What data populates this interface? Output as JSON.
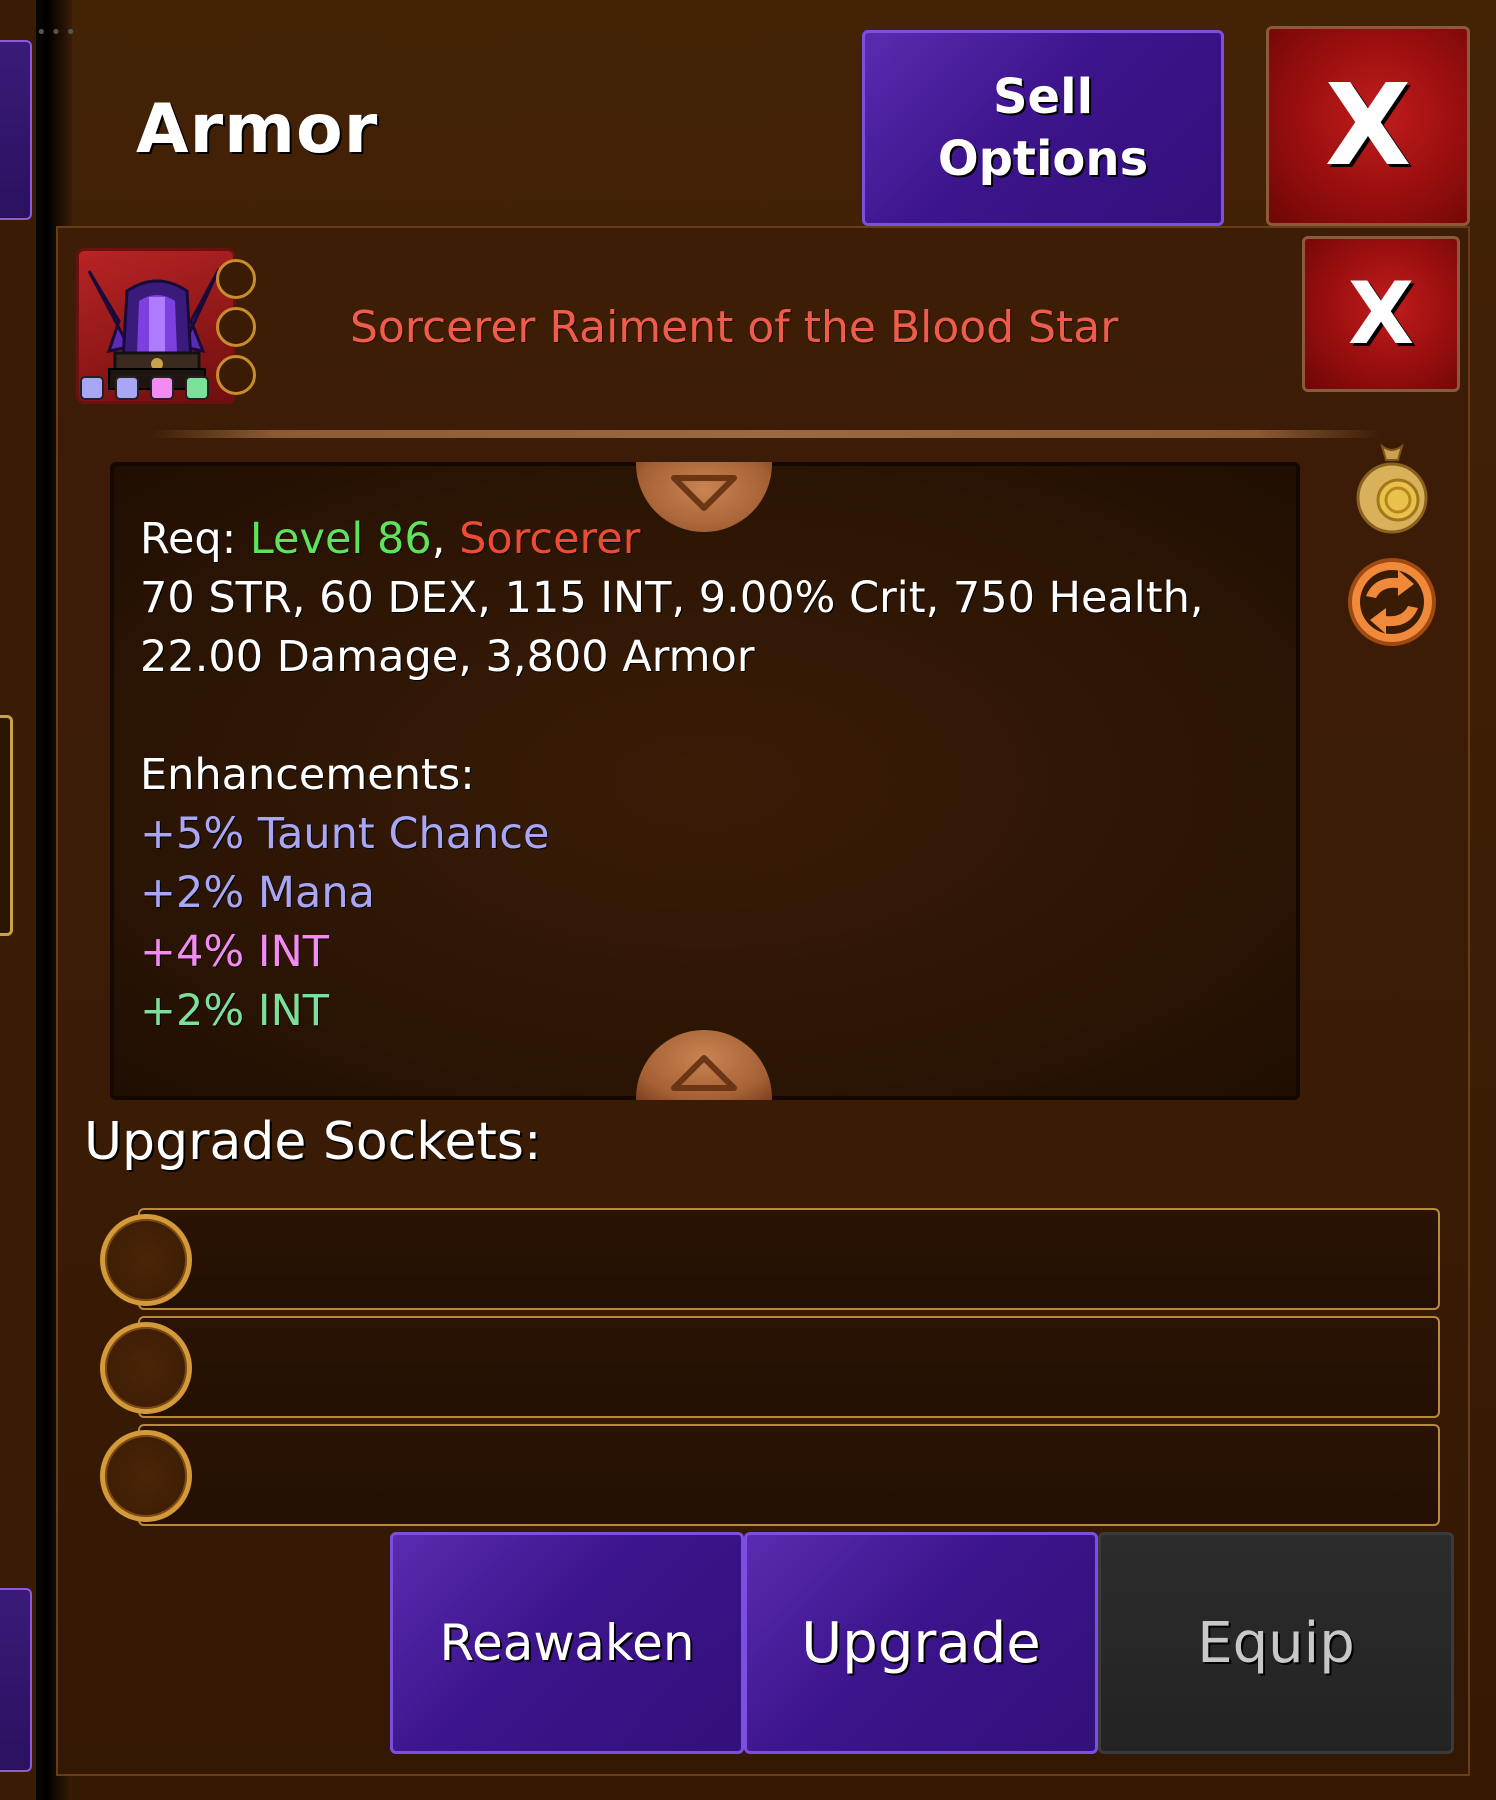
{
  "header": {
    "title": "Armor",
    "sell_options_line1": "Sell",
    "sell_options_line2": "Options",
    "close_label": "X"
  },
  "item": {
    "name": "Sorcerer Raiment of the Blood Star",
    "close_label": "X",
    "rarity_colors": [
      "#a9a7f5",
      "#a9a7f5",
      "#f28cf2",
      "#7de09a"
    ]
  },
  "requirements": {
    "prefix": "Req: ",
    "level": "Level 86",
    "separator": ", ",
    "class": "Sorcerer"
  },
  "stats": {
    "line1": "70 STR, 60 DEX, 115 INT, 9.00% Crit, 750 Health,",
    "line2": "22.00 Damage, 3,800 Armor"
  },
  "enhancements": {
    "title": "Enhancements:",
    "items": [
      {
        "text": "+5% Taunt Chance",
        "color": "#a9a7f5"
      },
      {
        "text": "+2% Mana",
        "color": "#a9a7f5"
      },
      {
        "text": "+4% INT",
        "color": "#f28cf2"
      },
      {
        "text": "+2% INT",
        "color": "#7de09a"
      }
    ]
  },
  "sockets": {
    "label": "Upgrade Sockets:",
    "slots": [
      "",
      "",
      ""
    ]
  },
  "side_icons": [
    "coin-bag-icon",
    "swap-icon"
  ],
  "buttons": {
    "reawaken": "Reawaken",
    "upgrade": "Upgrade",
    "equip": "Equip"
  }
}
